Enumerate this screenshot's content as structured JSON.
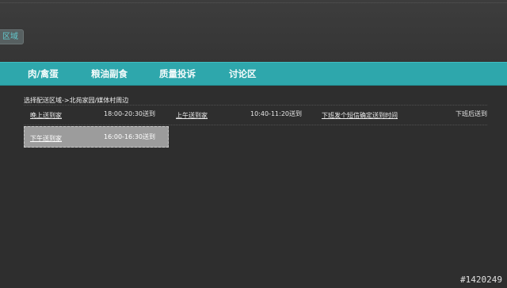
{
  "header": {
    "region_chip": "区域"
  },
  "nav": {
    "items": [
      {
        "label": "肉/禽蛋"
      },
      {
        "label": "粮油副食"
      },
      {
        "label": "质量投诉"
      },
      {
        "label": "讨论区"
      }
    ]
  },
  "delivery": {
    "area_title": "选择配送区域->北苑家园/媒体村周边",
    "row1": [
      {
        "label": "晚上送到家",
        "time": "18:00-20:30送到"
      },
      {
        "label": "上午送到家",
        "time": "10:40-11:20送到"
      },
      {
        "label": "下班发个短信确定送到时间",
        "time": "下班后送到"
      }
    ],
    "selected_slot": {
      "label": "下午送到家",
      "time": "16:00-16:30送到"
    }
  },
  "watermark": "#1420249",
  "colors": {
    "nav_teal": "#2ea7ac",
    "background": "#2e2e2e",
    "selected_slot_bg": "#9c9c9c",
    "chip_text": "#62c7cc"
  }
}
